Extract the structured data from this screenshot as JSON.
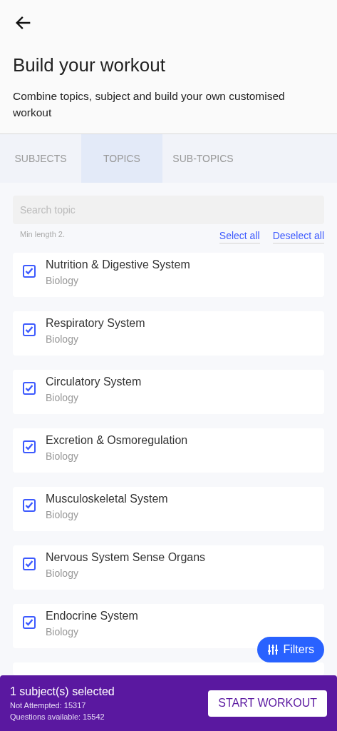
{
  "header": {
    "title": "Build your workout",
    "subtitle": "Combine topics, subject and build your own customised workout"
  },
  "tabs": [
    {
      "label": "SUBJECTS",
      "selected": false
    },
    {
      "label": "TOPICS",
      "selected": true
    },
    {
      "label": "SUB-TOPICS",
      "selected": false
    }
  ],
  "search": {
    "placeholder": "Search topic",
    "hint": "Min length 2."
  },
  "actions": [
    "Select all",
    "Deselect all"
  ],
  "topics": [
    {
      "name": "Nutrition & Digestive System",
      "subject": "Biology",
      "checked": true
    },
    {
      "name": "Respiratory System",
      "subject": "Biology",
      "checked": true
    },
    {
      "name": "Circulatory System",
      "subject": "Biology",
      "checked": true
    },
    {
      "name": "Excretion & Osmoregulation",
      "subject": "Biology",
      "checked": true
    },
    {
      "name": "Musculoskeletal System",
      "subject": "Biology",
      "checked": true
    },
    {
      "name": "Nervous System Sense Organs",
      "subject": "Biology",
      "checked": true
    },
    {
      "name": "Endocrine System",
      "subject": "Biology",
      "checked": true
    }
  ],
  "filters_button": "Filters",
  "footer": {
    "selected": "1 subject(s) selected",
    "not_attempted": "Not Attempted: 15317",
    "questions": "Questions available: 15542",
    "button": "START WORKOUT"
  }
}
